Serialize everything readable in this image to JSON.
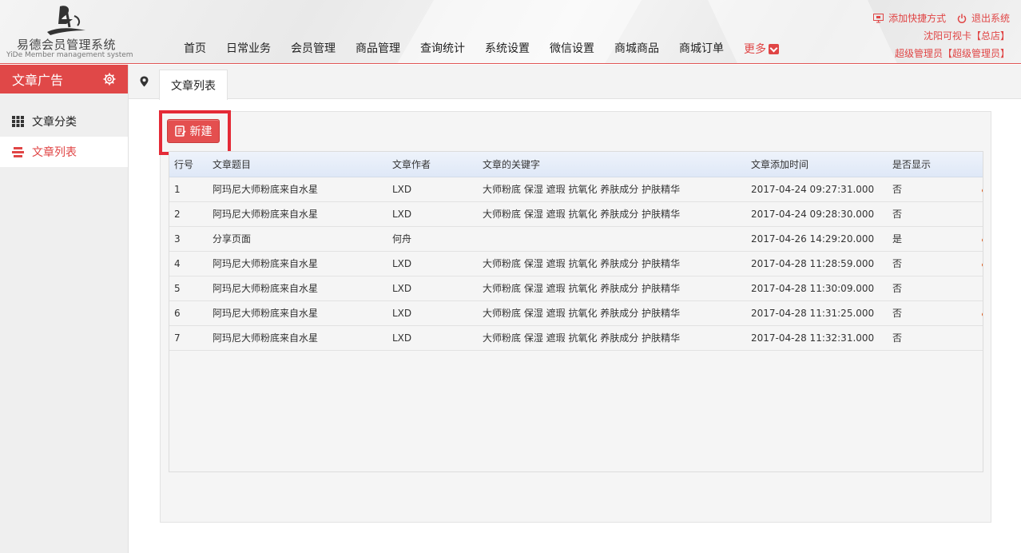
{
  "brand": {
    "name_cn": "易德会员管理系统",
    "name_en": "YiDe Member management system"
  },
  "nav": [
    "首页",
    "日常业务",
    "会员管理",
    "商品管理",
    "查询统计",
    "系统设置",
    "微信设置",
    "商城商品",
    "商城订单"
  ],
  "nav_more": "更多",
  "top_right": {
    "add_shortcut": "添加快捷方式",
    "logout": "退出系统",
    "store": "沈阳可视卡【总店】",
    "user": "超级管理员【超级管理员】"
  },
  "sidebar": {
    "title": "文章广告",
    "items": [
      {
        "label": "文章分类",
        "icon": "grid-icon",
        "active": false
      },
      {
        "label": "文章列表",
        "icon": "list-icon",
        "active": true
      }
    ]
  },
  "tabs": [
    {
      "label": "文章列表"
    }
  ],
  "toolbar": {
    "new_label": "新建"
  },
  "table": {
    "columns": [
      "行号",
      "文章题目",
      "文章作者",
      "文章的关键字",
      "文章添加时间",
      "是否显示"
    ],
    "rows": [
      [
        "1",
        "阿玛尼大师粉底来自水星",
        "LXD",
        "大师粉底 保湿 遮瑕 抗氧化 养肤成分 护肤精华",
        "2017-04-24 09:27:31.000",
        "否"
      ],
      [
        "2",
        "阿玛尼大师粉底来自水星",
        "LXD",
        "大师粉底 保湿 遮瑕 抗氧化 养肤成分 护肤精华",
        "2017-04-24 09:28:30.000",
        "否"
      ],
      [
        "3",
        "分享页面",
        "何舟",
        "",
        "2017-04-26 14:29:20.000",
        "是"
      ],
      [
        "4",
        "阿玛尼大师粉底来自水星",
        "LXD",
        "大师粉底 保湿 遮瑕 抗氧化 养肤成分 护肤精华",
        "2017-04-28 11:28:59.000",
        "否"
      ],
      [
        "5",
        "阿玛尼大师粉底来自水星",
        "LXD",
        "大师粉底 保湿 遮瑕 抗氧化 养肤成分 护肤精华",
        "2017-04-28 11:30:09.000",
        "否"
      ],
      [
        "6",
        "阿玛尼大师粉底来自水星",
        "LXD",
        "大师粉底 保湿 遮瑕 抗氧化 养肤成分 护肤精华",
        "2017-04-28 11:31:25.000",
        "否"
      ],
      [
        "7",
        "阿玛尼大师粉底来自水星",
        "LXD",
        "大师粉底 保湿 遮瑕 抗氧化 养肤成分 护肤精华",
        "2017-04-28 11:32:31.000",
        "否"
      ]
    ]
  },
  "colors": {
    "accent": "#e04848",
    "highlight_box": "#e42a36"
  }
}
